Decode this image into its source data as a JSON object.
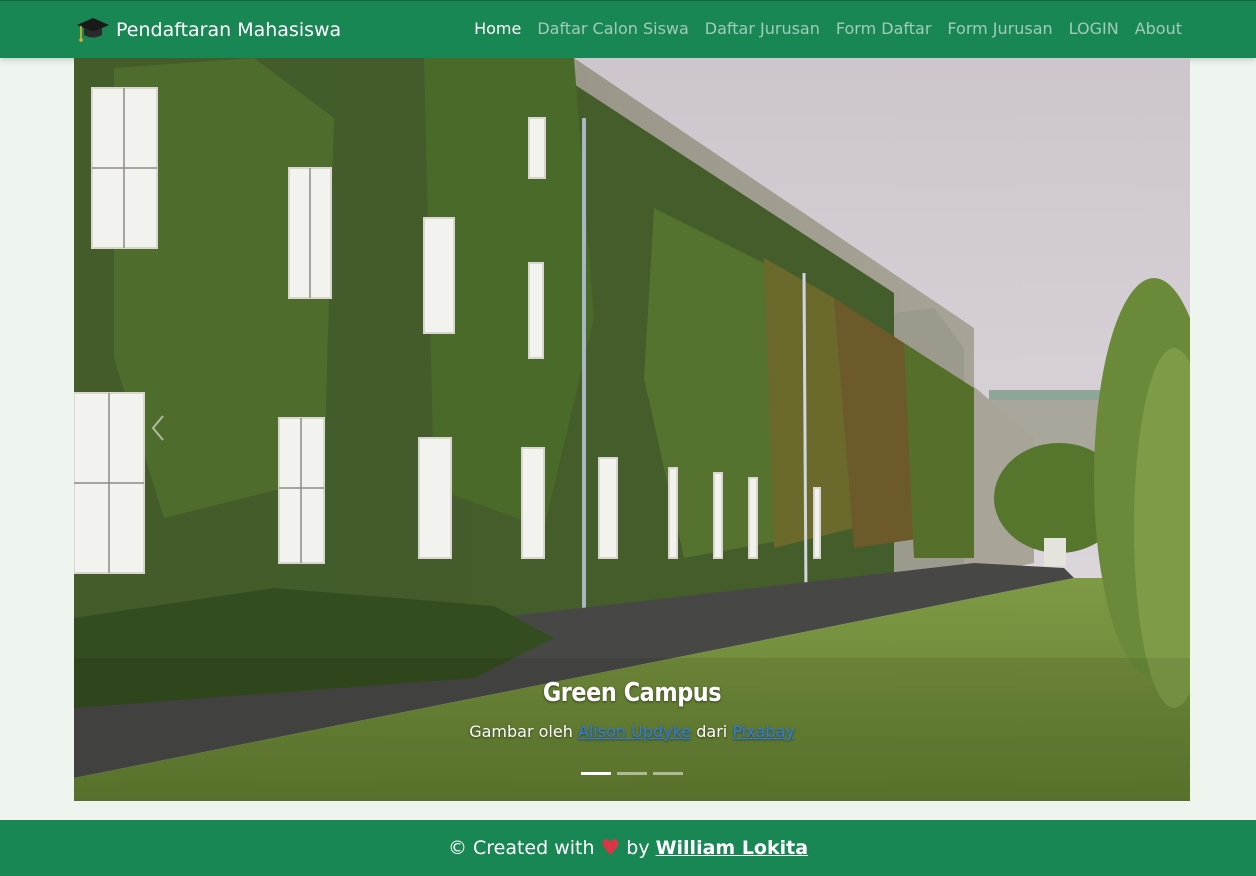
{
  "navbar": {
    "brand": "Pendaftaran Mahasiswa",
    "brand_icon": "graduation-cap-icon",
    "links": [
      {
        "label": "Home",
        "active": true
      },
      {
        "label": "Daftar Calon Siswa",
        "active": false
      },
      {
        "label": "Daftar Jurusan",
        "active": false
      },
      {
        "label": "Form Daftar",
        "active": false
      },
      {
        "label": "Form Jurusan",
        "active": false
      },
      {
        "label": "LOGIN",
        "active": false
      },
      {
        "label": "About",
        "active": false
      }
    ]
  },
  "carousel": {
    "slide_title": "Green Campus",
    "credit_prefix": "Gambar oleh",
    "credit_author": "Alison Updyke",
    "credit_mid": "dari",
    "credit_source": "Pixabay",
    "indicator_count": 3,
    "active_indicator": 0
  },
  "footer": {
    "prefix": "© Created with",
    "heart": "♥",
    "by": "by",
    "author": "William Lokita"
  },
  "colors": {
    "navbar_bg": "#198754",
    "footer_bg": "#198754",
    "page_bg": "#eef5ef",
    "link_color": "#2b7de9",
    "heart_color": "#dc3545"
  }
}
